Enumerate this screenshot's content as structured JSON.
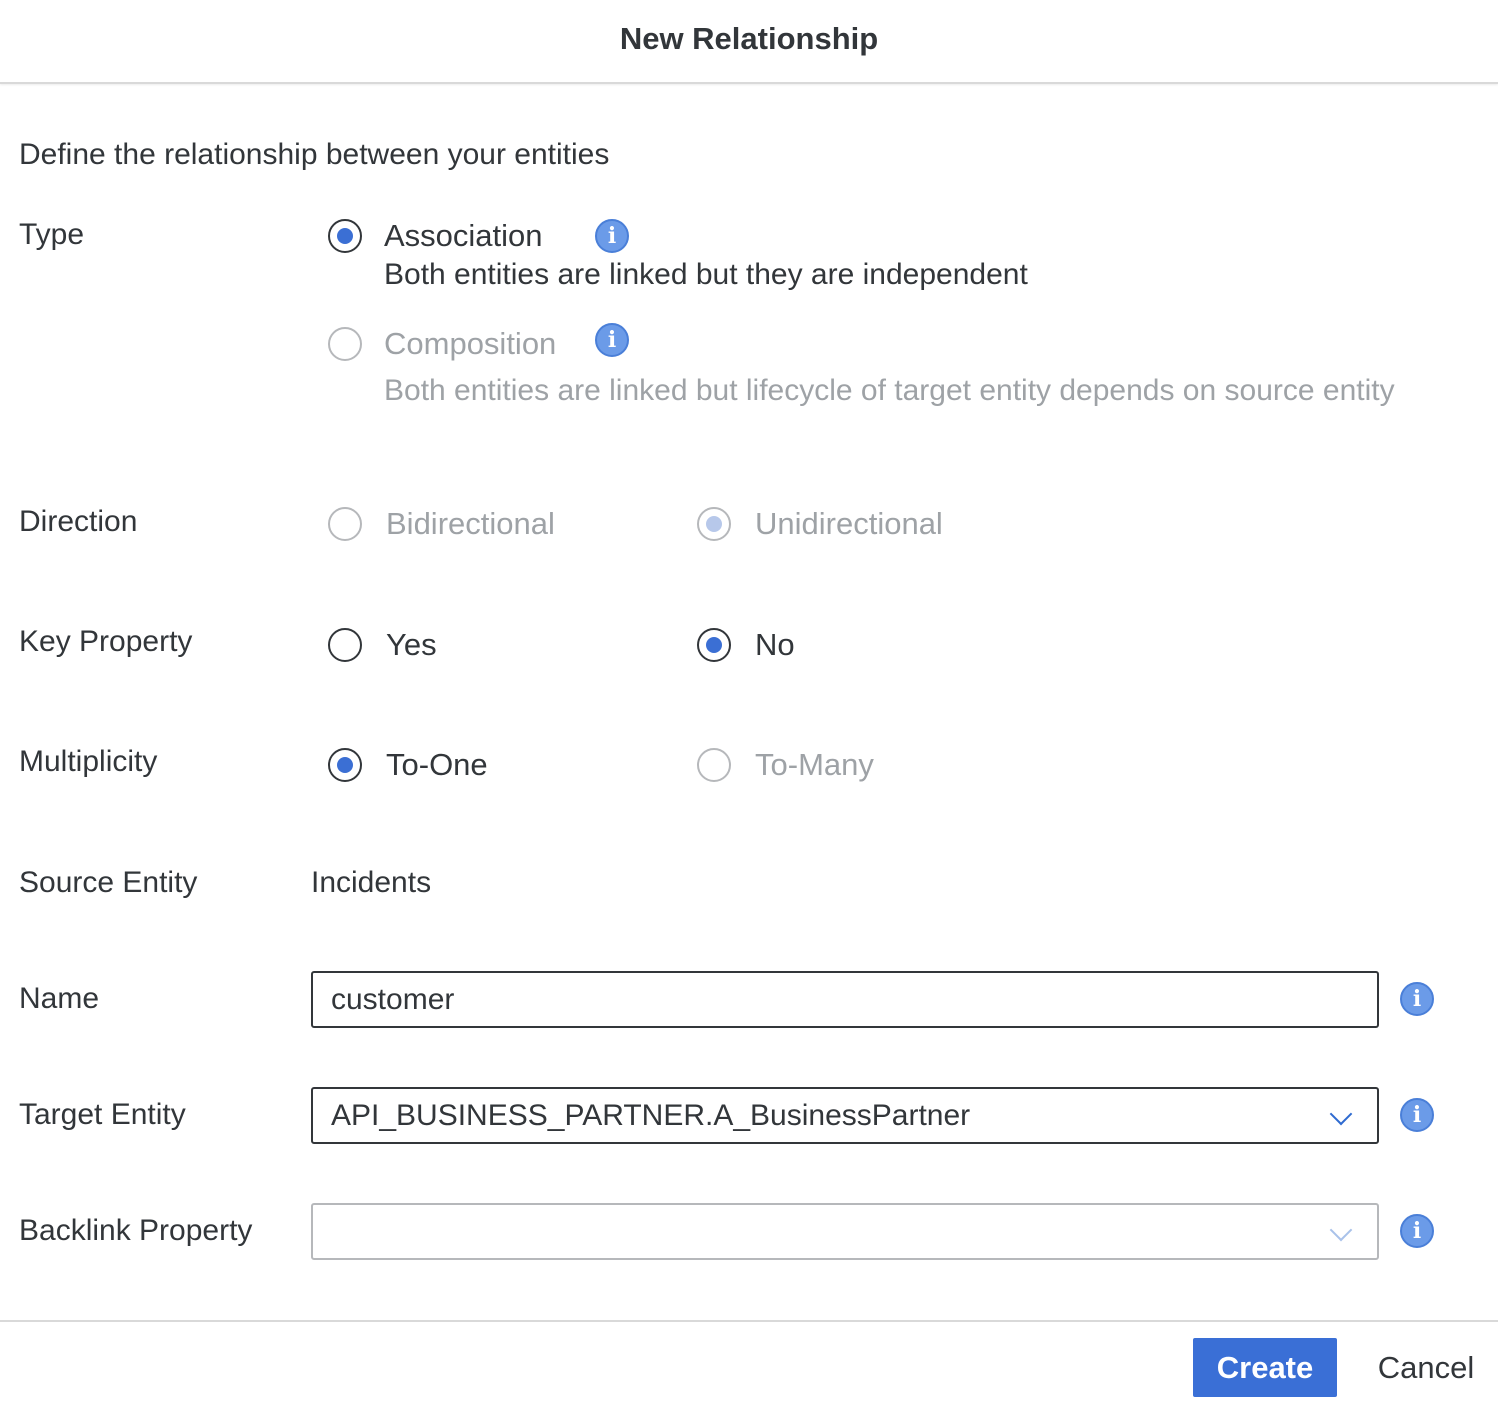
{
  "dialog": {
    "title": "New Relationship",
    "intro": "Define the relationship between your entities"
  },
  "type": {
    "label": "Type",
    "options": [
      {
        "label": "Association",
        "description": "Both entities are linked but they are independent",
        "selected": true,
        "disabled": false,
        "info_icon": "info-icon"
      },
      {
        "label": "Composition",
        "description": "Both entities are linked but lifecycle of target entity depends on source entity",
        "selected": false,
        "disabled": true,
        "info_icon": "info-icon"
      }
    ]
  },
  "direction": {
    "label": "Direction",
    "options": [
      {
        "label": "Bidirectional",
        "selected": false,
        "disabled": true
      },
      {
        "label": "Unidirectional",
        "selected": true,
        "disabled": true
      }
    ]
  },
  "key_property": {
    "label": "Key Property",
    "options": [
      {
        "label": "Yes",
        "selected": false,
        "disabled": false
      },
      {
        "label": "No",
        "selected": true,
        "disabled": false
      }
    ]
  },
  "multiplicity": {
    "label": "Multiplicity",
    "options": [
      {
        "label": "To-One",
        "selected": true,
        "disabled": false
      },
      {
        "label": "To-Many",
        "selected": false,
        "disabled": true
      }
    ]
  },
  "source_entity": {
    "label": "Source Entity",
    "value": "Incidents"
  },
  "name": {
    "label": "Name",
    "value": "customer"
  },
  "target_entity": {
    "label": "Target Entity",
    "value": "API_BUSINESS_PARTNER.A_BusinessPartner"
  },
  "backlink_property": {
    "label": "Backlink Property",
    "value": ""
  },
  "footer": {
    "create_label": "Create",
    "cancel_label": "Cancel"
  },
  "colors": {
    "accent": "#3a6fd6",
    "text": "#32363a",
    "disabled_text": "#9ea2a6",
    "info_icon": "#6b9be8"
  }
}
